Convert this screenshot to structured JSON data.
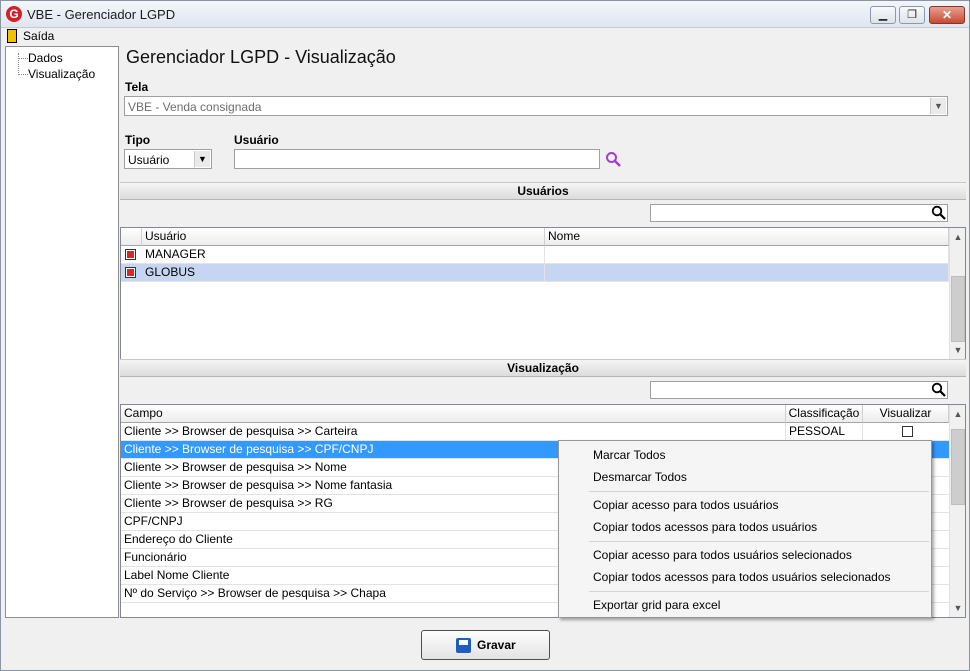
{
  "window": {
    "title": "VBE - Gerenciador LGPD",
    "app_icon": "G"
  },
  "menu": {
    "exit_label": "Saída"
  },
  "tree": {
    "items": [
      "Dados",
      "Visualização"
    ]
  },
  "page": {
    "title": "Gerenciador LGPD - Visualização"
  },
  "form": {
    "tela_label": "Tela",
    "tela_value": "VBE - Venda consignada",
    "tipo_label": "Tipo",
    "tipo_value": "Usuário",
    "usuario_label": "Usuário",
    "usuario_value": ""
  },
  "users_section": {
    "title": "Usuários",
    "columns": [
      "Usuário",
      "Nome"
    ],
    "rows": [
      {
        "usuario": "MANAGER",
        "nome": "",
        "checked": true
      },
      {
        "usuario": "GLOBUS",
        "nome": "",
        "checked": true
      }
    ]
  },
  "view_section": {
    "title": "Visualização",
    "columns": [
      "Campo",
      "Classificação",
      "Visualizar"
    ],
    "rows": [
      {
        "campo": "Cliente >> Browser de pesquisa >> Carteira",
        "classificacao": "PESSOAL",
        "visualizar": false
      },
      {
        "campo": "Cliente >> Browser de pesquisa >> CPF/CNPJ"
      },
      {
        "campo": "Cliente >> Browser de pesquisa >> Nome"
      },
      {
        "campo": "Cliente >> Browser de pesquisa >> Nome fantasia"
      },
      {
        "campo": "Cliente >> Browser de pesquisa >> RG"
      },
      {
        "campo": "CPF/CNPJ"
      },
      {
        "campo": "Endereço do Cliente"
      },
      {
        "campo": "Funcionário"
      },
      {
        "campo": "Label Nome Cliente"
      },
      {
        "campo": "Nº do Serviço >> Browser de pesquisa >> Chapa"
      }
    ]
  },
  "context_menu": {
    "items": [
      "Marcar Todos",
      "Desmarcar Todos",
      "Copiar acesso para todos usuários",
      "Copiar todos acessos para todos usuários",
      "Copiar acesso para todos usuários selecionados",
      "Copiar todos acessos para todos usuários selecionados",
      "Exportar grid para excel"
    ]
  },
  "footer": {
    "save_label": "Gravar"
  }
}
